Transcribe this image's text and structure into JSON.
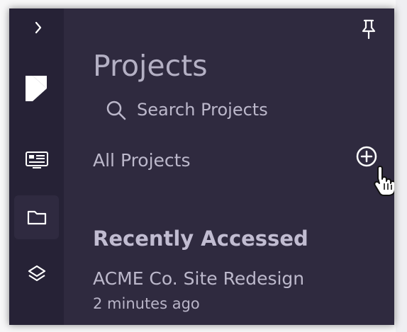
{
  "panel": {
    "title": "Projects",
    "search": {
      "placeholder": "Search Projects"
    },
    "all_projects_label": "All Projects",
    "recently_accessed": {
      "heading": "Recently Accessed",
      "items": [
        {
          "name": "ACME Co. Site Redesign",
          "time": "2 minutes ago"
        }
      ]
    }
  },
  "rail": {
    "items": [
      {
        "icon": "chevron-right-icon",
        "active": false
      },
      {
        "icon": "logo-icon",
        "active": false
      },
      {
        "icon": "dashboard-icon",
        "active": false
      },
      {
        "icon": "folder-icon",
        "active": true
      },
      {
        "icon": "layers-icon",
        "active": false
      }
    ]
  },
  "icons": {
    "pin": "pin-icon",
    "search": "search-icon",
    "add": "plus-circle-icon",
    "cursor": "hand-pointer-icon"
  },
  "colors": {
    "panel_bg": "#2f2a3f",
    "rail_bg": "#262236",
    "active_bg": "#2f2a40",
    "text": "#bcb8cb",
    "icon": "#ffffff"
  }
}
